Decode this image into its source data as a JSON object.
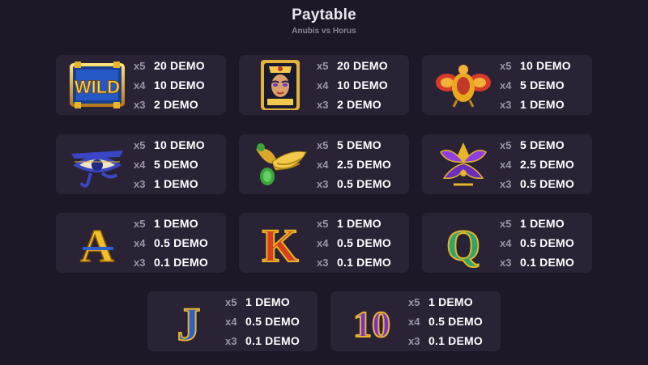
{
  "header": {
    "title": "Paytable",
    "subtitle": "Anubis vs Horus"
  },
  "rows": [
    [
      {
        "icon": "wild-icon",
        "pays": [
          {
            "m": "x5",
            "v": "20 DEMO"
          },
          {
            "m": "x4",
            "v": "10 DEMO"
          },
          {
            "m": "x3",
            "v": "2 DEMO"
          }
        ]
      },
      {
        "icon": "cleopatra-icon",
        "pays": [
          {
            "m": "x5",
            "v": "20 DEMO"
          },
          {
            "m": "x4",
            "v": "10 DEMO"
          },
          {
            "m": "x3",
            "v": "2 DEMO"
          }
        ]
      },
      {
        "icon": "scarab-icon",
        "pays": [
          {
            "m": "x5",
            "v": "10 DEMO"
          },
          {
            "m": "x4",
            "v": "5 DEMO"
          },
          {
            "m": "x3",
            "v": "1 DEMO"
          }
        ]
      }
    ],
    [
      {
        "icon": "eye-of-horus-icon",
        "pays": [
          {
            "m": "x5",
            "v": "10 DEMO"
          },
          {
            "m": "x4",
            "v": "5 DEMO"
          },
          {
            "m": "x3",
            "v": "1 DEMO"
          }
        ]
      },
      {
        "icon": "winged-ankh-icon",
        "pays": [
          {
            "m": "x5",
            "v": "5 DEMO"
          },
          {
            "m": "x4",
            "v": "2.5 DEMO"
          },
          {
            "m": "x3",
            "v": "0.5 DEMO"
          }
        ]
      },
      {
        "icon": "lotus-icon",
        "pays": [
          {
            "m": "x5",
            "v": "5 DEMO"
          },
          {
            "m": "x4",
            "v": "2.5 DEMO"
          },
          {
            "m": "x3",
            "v": "0.5 DEMO"
          }
        ]
      }
    ],
    [
      {
        "icon": "letter-a-icon",
        "pays": [
          {
            "m": "x5",
            "v": "1 DEMO"
          },
          {
            "m": "x4",
            "v": "0.5 DEMO"
          },
          {
            "m": "x3",
            "v": "0.1 DEMO"
          }
        ]
      },
      {
        "icon": "letter-k-icon",
        "pays": [
          {
            "m": "x5",
            "v": "1 DEMO"
          },
          {
            "m": "x4",
            "v": "0.5 DEMO"
          },
          {
            "m": "x3",
            "v": "0.1 DEMO"
          }
        ]
      },
      {
        "icon": "letter-q-icon",
        "pays": [
          {
            "m": "x5",
            "v": "1 DEMO"
          },
          {
            "m": "x4",
            "v": "0.5 DEMO"
          },
          {
            "m": "x3",
            "v": "0.1 DEMO"
          }
        ]
      }
    ],
    [
      {
        "icon": "letter-j-icon",
        "pays": [
          {
            "m": "x5",
            "v": "1 DEMO"
          },
          {
            "m": "x4",
            "v": "0.5 DEMO"
          },
          {
            "m": "x3",
            "v": "0.1 DEMO"
          }
        ]
      },
      {
        "icon": "letter-10-icon",
        "pays": [
          {
            "m": "x5",
            "v": "1 DEMO"
          },
          {
            "m": "x4",
            "v": "0.5 DEMO"
          },
          {
            "m": "x3",
            "v": "0.1 DEMO"
          }
        ]
      }
    ]
  ],
  "icon_labels": {
    "wild": "WILD",
    "a": "A",
    "k": "K",
    "q": "Q",
    "j": "J",
    "ten": "10"
  },
  "colors": {
    "background": "#1d1728",
    "card": "#2a2336",
    "multiplier": "#9b95a6",
    "gold": "#e7b52a",
    "purple": "#7a3bd1"
  }
}
